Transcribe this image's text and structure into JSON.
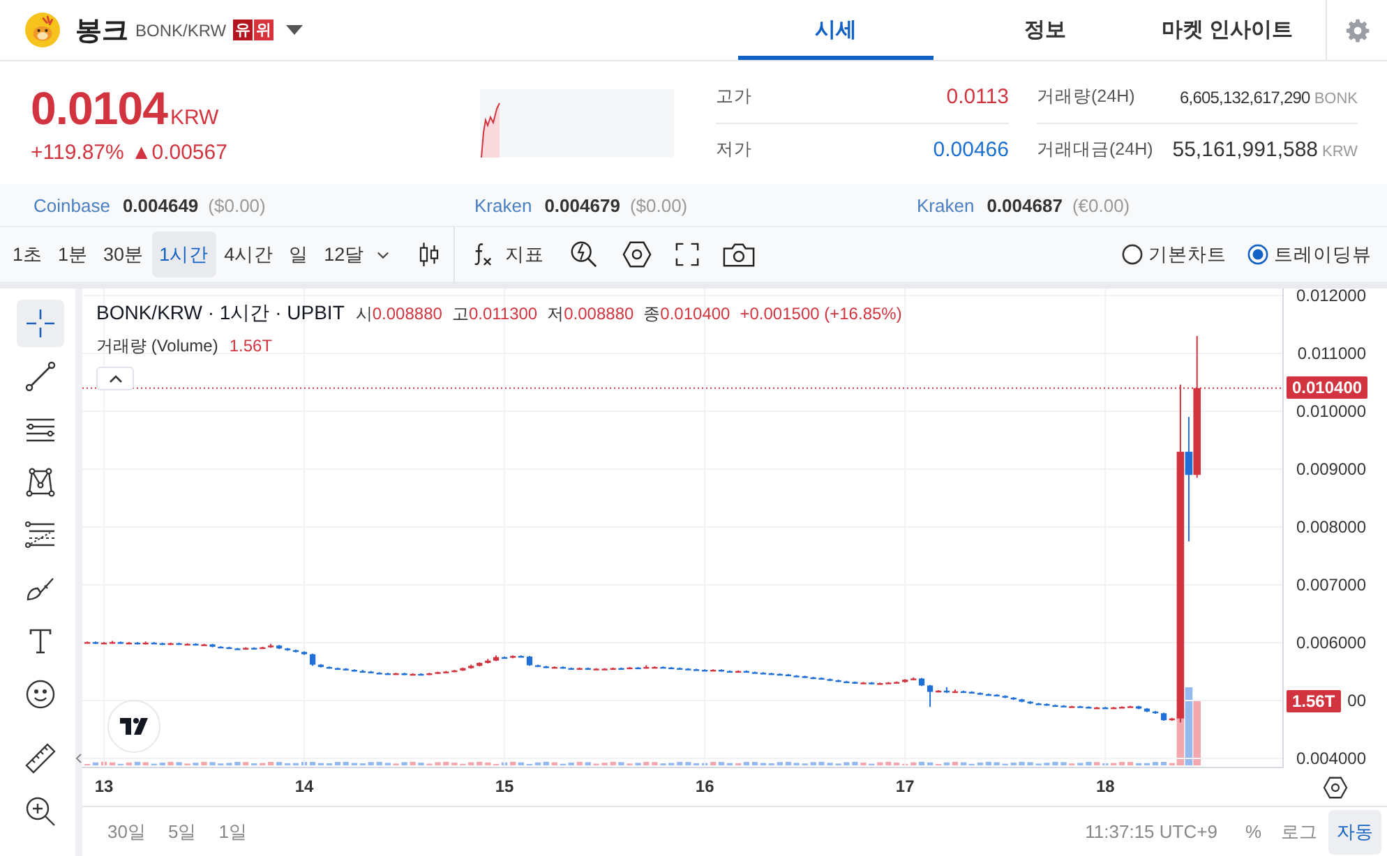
{
  "header": {
    "coin_name": "봉크",
    "pair": "BONK/KRW",
    "badges": [
      "유",
      "위"
    ]
  },
  "tabs": [
    {
      "label": "시세",
      "selected": true
    },
    {
      "label": "정보",
      "selected": false
    },
    {
      "label": "마켓 인사이트",
      "selected": false
    }
  ],
  "price": {
    "value": "0.0104",
    "unit": "KRW",
    "change_rate": "+119.87%",
    "change_amount": "▲0.00567"
  },
  "range": [
    {
      "label": "고가",
      "value": "0.0113",
      "color": "#d2343f"
    },
    {
      "label": "저가",
      "value": "0.00466",
      "color": "#1a6fd1"
    }
  ],
  "volume": [
    {
      "label": "거래량(24H)",
      "value": "6,605,132,617,290",
      "unit": "BONK"
    },
    {
      "label": "거래대금(24H)",
      "value": "55,161,991,588",
      "unit": "KRW"
    }
  ],
  "exchanges": [
    {
      "name": "Coinbase",
      "price": "0.004649",
      "converted": "($0.00)"
    },
    {
      "name": "Kraken",
      "price": "0.004679",
      "converted": "($0.00)"
    },
    {
      "name": "Kraken",
      "price": "0.004687",
      "converted": "(€0.00)"
    }
  ],
  "toolbar": {
    "intervals": [
      {
        "label": "1초",
        "selected": false
      },
      {
        "label": "1분",
        "selected": false
      },
      {
        "label": "30분",
        "selected": false
      },
      {
        "label": "1시간",
        "selected": true
      },
      {
        "label": "4시간",
        "selected": false
      },
      {
        "label": "일",
        "selected": false
      },
      {
        "label": "12달",
        "selected": false
      }
    ],
    "indicator_label": "지표",
    "chart_types": [
      {
        "label": "기본차트",
        "selected": false
      },
      {
        "label": "트레이딩뷰",
        "selected": true
      }
    ]
  },
  "drawing_tool_groups": [
    {
      "tools": [
        {
          "kind": "crosshair",
          "selected": true
        },
        {
          "kind": "trend-line",
          "selected": false
        },
        {
          "kind": "horizontal-lines",
          "selected": false
        },
        {
          "kind": "pattern",
          "selected": false
        },
        {
          "kind": "levels",
          "selected": false
        },
        {
          "kind": "brush",
          "selected": false
        },
        {
          "kind": "text",
          "selected": false
        },
        {
          "kind": "smiley",
          "selected": false
        }
      ]
    },
    {
      "tools": [
        {
          "kind": "ruler",
          "selected": false
        },
        {
          "kind": "zoom-in",
          "selected": false
        }
      ]
    }
  ],
  "chart": {
    "legend": {
      "title": "BONK/KRW · 1시간 · UPBIT",
      "ohlc": [
        {
          "label": "시",
          "value": "0.008880"
        },
        {
          "label": "고",
          "value": "0.011300"
        },
        {
          "label": "저",
          "value": "0.008880"
        },
        {
          "label": "종",
          "value": "0.010400"
        }
      ],
      "change": "+0.001500 (+16.85%)",
      "volume_label": "거래량 (Volume)",
      "volume_value": "1.56T"
    },
    "chart_data": {
      "type": "candlestick",
      "grid": true,
      "xlim": [
        12.892,
        18.891
      ],
      "ylim": [
        0.003831,
        0.01212
      ],
      "xticks": [
        {
          "value": 13,
          "label": "13"
        },
        {
          "value": 14,
          "label": "14"
        },
        {
          "value": 15,
          "label": "15"
        },
        {
          "value": 16,
          "label": "16"
        },
        {
          "value": 17,
          "label": "17"
        },
        {
          "value": 18,
          "label": "18"
        }
      ],
      "yticks": [
        {
          "value": 0.012,
          "label": "0.012000"
        },
        {
          "value": 0.011,
          "label": "0.011000"
        },
        {
          "value": 0.01,
          "label": "0.010000"
        },
        {
          "value": 0.009,
          "label": "0.009000"
        },
        {
          "value": 0.008,
          "label": "0.008000"
        },
        {
          "value": 0.007,
          "label": "0.007000"
        },
        {
          "value": 0.006,
          "label": "0.006000"
        },
        {
          "value": 0.005,
          "label": "00"
        },
        {
          "value": 0.004,
          "label": "0.004000"
        }
      ],
      "ref_lines": [
        {
          "axis": "y",
          "value": 0.0104,
          "label": "0.010400"
        }
      ],
      "x": [
        12.917,
        12.958,
        13,
        13.042,
        13.083,
        13.125,
        13.167,
        13.208,
        13.25,
        13.292,
        13.333,
        13.375,
        13.417,
        13.458,
        13.5,
        13.542,
        13.583,
        13.625,
        13.667,
        13.708,
        13.75,
        13.792,
        13.833,
        13.875,
        13.917,
        13.958,
        14,
        14.042,
        14.083,
        14.125,
        14.167,
        14.208,
        14.25,
        14.292,
        14.333,
        14.375,
        14.417,
        14.458,
        14.5,
        14.542,
        14.583,
        14.625,
        14.667,
        14.708,
        14.75,
        14.792,
        14.833,
        14.875,
        14.917,
        14.958,
        15,
        15.042,
        15.083,
        15.125,
        15.167,
        15.208,
        15.25,
        15.292,
        15.333,
        15.375,
        15.417,
        15.458,
        15.5,
        15.542,
        15.583,
        15.625,
        15.667,
        15.708,
        15.75,
        15.792,
        15.833,
        15.875,
        15.917,
        15.958,
        16,
        16.042,
        16.083,
        16.125,
        16.167,
        16.208,
        16.25,
        16.292,
        16.333,
        16.375,
        16.417,
        16.458,
        16.5,
        16.542,
        16.583,
        16.625,
        16.667,
        16.708,
        16.75,
        16.792,
        16.833,
        16.875,
        16.917,
        16.958,
        17,
        17.042,
        17.083,
        17.125,
        17.167,
        17.208,
        17.25,
        17.292,
        17.333,
        17.375,
        17.417,
        17.458,
        17.5,
        17.542,
        17.583,
        17.625,
        17.667,
        17.708,
        17.75,
        17.792,
        17.833,
        17.875,
        17.917,
        17.958,
        18,
        18.042,
        18.083,
        18.125,
        18.167,
        18.208,
        18.25,
        18.292,
        18.333,
        18.375,
        18.417,
        18.458
      ],
      "ohlc": [
        [
          0.006,
          0.00602,
          0.00599,
          0.00601
        ],
        [
          0.00601,
          0.00602,
          0.00598,
          0.00599
        ],
        [
          0.00599,
          0.00601,
          0.00598,
          0.006
        ],
        [
          0.006,
          0.00603,
          0.00599,
          0.00601
        ],
        [
          0.00601,
          0.00602,
          0.00598,
          0.00599
        ],
        [
          0.00599,
          0.00601,
          0.00598,
          0.006
        ],
        [
          0.006,
          0.00601,
          0.00597,
          0.00598
        ],
        [
          0.00598,
          0.00602,
          0.00597,
          0.006
        ],
        [
          0.006,
          0.00601,
          0.00598,
          0.00599
        ],
        [
          0.00599,
          0.006,
          0.00596,
          0.00597
        ],
        [
          0.00597,
          0.006,
          0.00596,
          0.00599
        ],
        [
          0.00599,
          0.006,
          0.00597,
          0.00598
        ],
        [
          0.00598,
          0.00599,
          0.00597,
          0.00598
        ],
        [
          0.00598,
          0.00599,
          0.00595,
          0.00596
        ],
        [
          0.00596,
          0.00598,
          0.00595,
          0.00597
        ],
        [
          0.00597,
          0.00598,
          0.00592,
          0.00593
        ],
        [
          0.00593,
          0.00594,
          0.00591,
          0.00592
        ],
        [
          0.00592,
          0.00593,
          0.00589,
          0.0059
        ],
        [
          0.0059,
          0.00591,
          0.00588,
          0.00589
        ],
        [
          0.00589,
          0.00592,
          0.00588,
          0.00591
        ],
        [
          0.00591,
          0.00592,
          0.00589,
          0.0059
        ],
        [
          0.0059,
          0.00593,
          0.00589,
          0.00592
        ],
        [
          0.00592,
          0.00598,
          0.00591,
          0.00595
        ],
        [
          0.00595,
          0.00596,
          0.00589,
          0.0059
        ],
        [
          0.0059,
          0.00591,
          0.00586,
          0.00587
        ],
        [
          0.00587,
          0.00588,
          0.00583,
          0.00584
        ],
        [
          0.00584,
          0.00585,
          0.00579,
          0.0058
        ],
        [
          0.0058,
          0.00581,
          0.0056,
          0.00562
        ],
        [
          0.00562,
          0.00563,
          0.00557,
          0.00558
        ],
        [
          0.00558,
          0.00559,
          0.00555,
          0.00556
        ],
        [
          0.00556,
          0.00557,
          0.00554,
          0.00555
        ],
        [
          0.00555,
          0.00556,
          0.00552,
          0.00553
        ],
        [
          0.00553,
          0.00554,
          0.0055,
          0.00551
        ],
        [
          0.00551,
          0.00553,
          0.00549,
          0.0055
        ],
        [
          0.0055,
          0.00551,
          0.00547,
          0.00548
        ],
        [
          0.00548,
          0.00549,
          0.00546,
          0.00547
        ],
        [
          0.00547,
          0.00548,
          0.00545,
          0.00546
        ],
        [
          0.00546,
          0.00548,
          0.00545,
          0.00547
        ],
        [
          0.00547,
          0.00548,
          0.00544,
          0.00545
        ],
        [
          0.00545,
          0.00547,
          0.00544,
          0.00546
        ],
        [
          0.00546,
          0.00547,
          0.00544,
          0.00545
        ],
        [
          0.00545,
          0.00548,
          0.00544,
          0.00547
        ],
        [
          0.00547,
          0.0055,
          0.00546,
          0.00549
        ],
        [
          0.00549,
          0.00551,
          0.00548,
          0.0055
        ],
        [
          0.0055,
          0.00553,
          0.00549,
          0.00552
        ],
        [
          0.00552,
          0.00557,
          0.00551,
          0.00556
        ],
        [
          0.00556,
          0.00562,
          0.00555,
          0.0056
        ],
        [
          0.0056,
          0.00566,
          0.00559,
          0.00565
        ],
        [
          0.00565,
          0.00572,
          0.00564,
          0.00569
        ],
        [
          0.00569,
          0.00578,
          0.00568,
          0.00575
        ],
        [
          0.00575,
          0.00576,
          0.00573,
          0.00574
        ],
        [
          0.00574,
          0.00578,
          0.00573,
          0.00577
        ],
        [
          0.00577,
          0.00578,
          0.00575,
          0.00576
        ],
        [
          0.00576,
          0.00577,
          0.0056,
          0.00561
        ],
        [
          0.00561,
          0.00562,
          0.00558,
          0.00559
        ],
        [
          0.00559,
          0.0056,
          0.00556,
          0.00557
        ],
        [
          0.00557,
          0.00559,
          0.00556,
          0.00558
        ],
        [
          0.00558,
          0.00559,
          0.00555,
          0.00556
        ],
        [
          0.00556,
          0.00557,
          0.00554,
          0.00555
        ],
        [
          0.00555,
          0.00557,
          0.00554,
          0.00556
        ],
        [
          0.00556,
          0.00557,
          0.00553,
          0.00554
        ],
        [
          0.00554,
          0.00556,
          0.00553,
          0.00555
        ],
        [
          0.00555,
          0.00556,
          0.00554,
          0.00555
        ],
        [
          0.00555,
          0.00557,
          0.00554,
          0.00556
        ],
        [
          0.00556,
          0.00557,
          0.00554,
          0.00555
        ],
        [
          0.00555,
          0.00558,
          0.00554,
          0.00557
        ],
        [
          0.00557,
          0.00558,
          0.00555,
          0.00556
        ],
        [
          0.00556,
          0.00561,
          0.00555,
          0.00558
        ],
        [
          0.00558,
          0.00559,
          0.00557,
          0.00558
        ],
        [
          0.00558,
          0.00559,
          0.00556,
          0.00557
        ],
        [
          0.00557,
          0.00558,
          0.00555,
          0.00556
        ],
        [
          0.00556,
          0.00557,
          0.00554,
          0.00555
        ],
        [
          0.00555,
          0.00556,
          0.00553,
          0.00554
        ],
        [
          0.00554,
          0.00555,
          0.00552,
          0.00553
        ],
        [
          0.00553,
          0.00554,
          0.00551,
          0.00552
        ],
        [
          0.00552,
          0.00554,
          0.00551,
          0.00553
        ],
        [
          0.00553,
          0.00554,
          0.0055,
          0.00551
        ],
        [
          0.00551,
          0.00552,
          0.00549,
          0.0055
        ],
        [
          0.0055,
          0.00552,
          0.00549,
          0.00551
        ],
        [
          0.00551,
          0.00552,
          0.00548,
          0.00549
        ],
        [
          0.00549,
          0.0055,
          0.00547,
          0.00548
        ],
        [
          0.00548,
          0.00549,
          0.00546,
          0.00547
        ],
        [
          0.00547,
          0.00548,
          0.00545,
          0.00546
        ],
        [
          0.00546,
          0.00547,
          0.00544,
          0.00545
        ],
        [
          0.00545,
          0.00546,
          0.00542,
          0.00543
        ],
        [
          0.00543,
          0.00544,
          0.00541,
          0.00542
        ],
        [
          0.00542,
          0.00543,
          0.00539,
          0.0054
        ],
        [
          0.0054,
          0.00541,
          0.00538,
          0.00539
        ],
        [
          0.00539,
          0.0054,
          0.00536,
          0.00537
        ],
        [
          0.00537,
          0.00538,
          0.00534,
          0.00535
        ],
        [
          0.00535,
          0.00536,
          0.00532,
          0.00533
        ],
        [
          0.00533,
          0.00534,
          0.00531,
          0.00532
        ],
        [
          0.00532,
          0.00533,
          0.00529,
          0.0053
        ],
        [
          0.0053,
          0.00532,
          0.00529,
          0.00531
        ],
        [
          0.00531,
          0.00532,
          0.00528,
          0.00529
        ],
        [
          0.00529,
          0.00531,
          0.00528,
          0.0053
        ],
        [
          0.0053,
          0.00532,
          0.00529,
          0.00531
        ],
        [
          0.00531,
          0.00533,
          0.0053,
          0.00532
        ],
        [
          0.00532,
          0.00537,
          0.00531,
          0.00536
        ],
        [
          0.00536,
          0.0054,
          0.00535,
          0.00538
        ],
        [
          0.00538,
          0.00539,
          0.00525,
          0.00526
        ],
        [
          0.00526,
          0.00527,
          0.00489,
          0.00515
        ],
        [
          0.00515,
          0.00518,
          0.00514,
          0.00517
        ],
        [
          0.00517,
          0.00523,
          0.00513,
          0.00514
        ],
        [
          0.00514,
          0.00519,
          0.00513,
          0.00516
        ],
        [
          0.00516,
          0.00517,
          0.00514,
          0.00515
        ],
        [
          0.00515,
          0.00516,
          0.00512,
          0.00513
        ],
        [
          0.00513,
          0.00514,
          0.0051,
          0.00511
        ],
        [
          0.00511,
          0.00512,
          0.00509,
          0.0051
        ],
        [
          0.0051,
          0.00511,
          0.00507,
          0.00508
        ],
        [
          0.00508,
          0.00509,
          0.00504,
          0.00505
        ],
        [
          0.00505,
          0.00506,
          0.00501,
          0.00502
        ],
        [
          0.00502,
          0.00503,
          0.00497,
          0.00498
        ],
        [
          0.00498,
          0.00499,
          0.00494,
          0.00495
        ],
        [
          0.00495,
          0.00496,
          0.00493,
          0.00494
        ],
        [
          0.00494,
          0.00495,
          0.00491,
          0.00492
        ],
        [
          0.00492,
          0.00493,
          0.0049,
          0.00491
        ],
        [
          0.00491,
          0.00492,
          0.00489,
          0.0049
        ],
        [
          0.0049,
          0.00491,
          0.00489,
          0.0049
        ],
        [
          0.0049,
          0.00491,
          0.00488,
          0.00489
        ],
        [
          0.00489,
          0.0049,
          0.00487,
          0.00488
        ],
        [
          0.00488,
          0.00489,
          0.00487,
          0.00488
        ],
        [
          0.00488,
          0.00489,
          0.00486,
          0.00487
        ],
        [
          0.00487,
          0.00489,
          0.00486,
          0.00488
        ],
        [
          0.00488,
          0.0049,
          0.00487,
          0.00489
        ],
        [
          0.00489,
          0.00491,
          0.00488,
          0.0049
        ],
        [
          0.0049,
          0.00491,
          0.00485,
          0.00486
        ],
        [
          0.00486,
          0.00487,
          0.0048,
          0.00481
        ],
        [
          0.00481,
          0.00482,
          0.00477,
          0.00478
        ],
        [
          0.00478,
          0.00479,
          0.00465,
          0.00466
        ],
        [
          0.00466,
          0.0047,
          0.00465,
          0.00469
        ],
        [
          0.00469,
          0.01046,
          0.00462,
          0.0093
        ],
        [
          0.0093,
          0.0099,
          0.00775,
          0.0089
        ],
        [
          0.0089,
          0.0113,
          0.00885,
          0.0104
        ]
      ]
    },
    "last_volume": "1.56T"
  },
  "bottom_bar": {
    "ranges": [
      "30일",
      "5일",
      "1일"
    ],
    "time": "11:37:15 UTC+9",
    "scales": [
      {
        "label": "%",
        "selected": false
      },
      {
        "label": "로그",
        "selected": false
      },
      {
        "label": "자동",
        "selected": true
      }
    ]
  }
}
